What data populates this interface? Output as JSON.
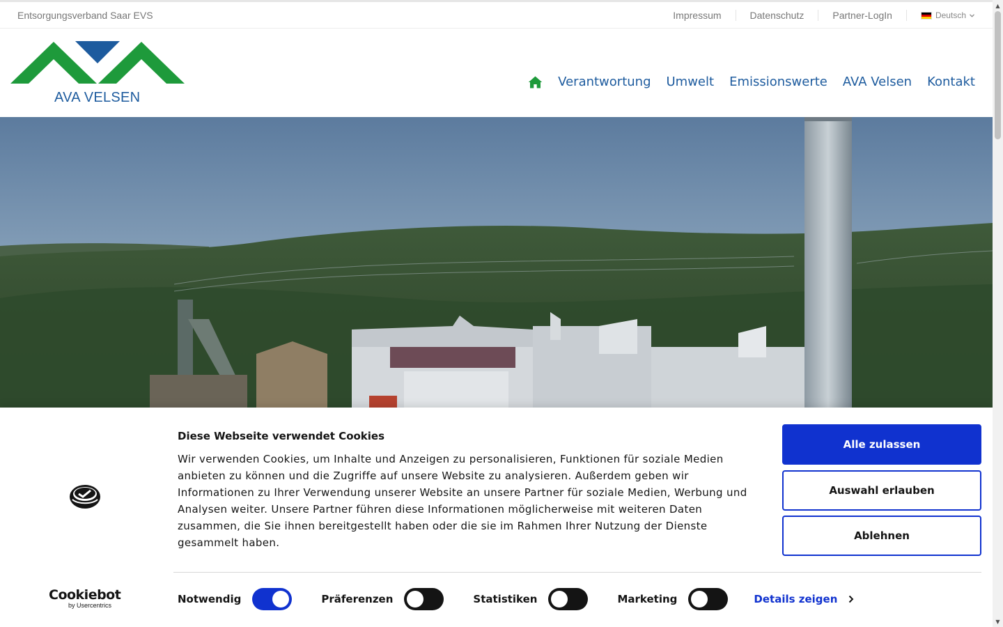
{
  "topbar": {
    "org": "Entsorgungsverband Saar EVS",
    "links": [
      "Impressum",
      "Datenschutz",
      "Partner-LogIn"
    ],
    "language": "Deutsch"
  },
  "header": {
    "logo_text": "AVA VELSEN",
    "nav": [
      "Verantwortung",
      "Umwelt",
      "Emissionswerte",
      "AVA Velsen",
      "Kontakt"
    ],
    "home_icon": "home-icon"
  },
  "cookie": {
    "title": "Diese Webseite verwendet Cookies",
    "text": "Wir verwenden Cookies, um Inhalte und Anzeigen zu personalisieren, Funktionen für soziale Medien anbieten zu können und die Zugriffe auf unsere Website zu analysieren. Außerdem geben wir Informationen zu Ihrer Verwendung unserer Website an unsere Partner für soziale Medien, Werbung und Analysen weiter. Unsere Partner führen diese Informationen möglicherweise mit weiteren Daten zusammen, die Sie ihnen bereitgestellt haben oder die sie im Rahmen Ihrer Nutzung der Dienste gesammelt haben.",
    "buttons": {
      "allow_all": "Alle zulassen",
      "allow_selection": "Auswahl erlauben",
      "deny": "Ablehnen"
    },
    "toggles": [
      {
        "label": "Notwendig",
        "on": true
      },
      {
        "label": "Präferenzen",
        "on": false
      },
      {
        "label": "Statistiken",
        "on": false
      },
      {
        "label": "Marketing",
        "on": false
      }
    ],
    "details": "Details zeigen",
    "brand": "Cookiebot",
    "brand_sub": "by Usercentrics"
  },
  "colors": {
    "brand_green": "#1e9a3b",
    "brand_blue": "#1d5b9e",
    "cookie_blue": "#1032cf"
  }
}
